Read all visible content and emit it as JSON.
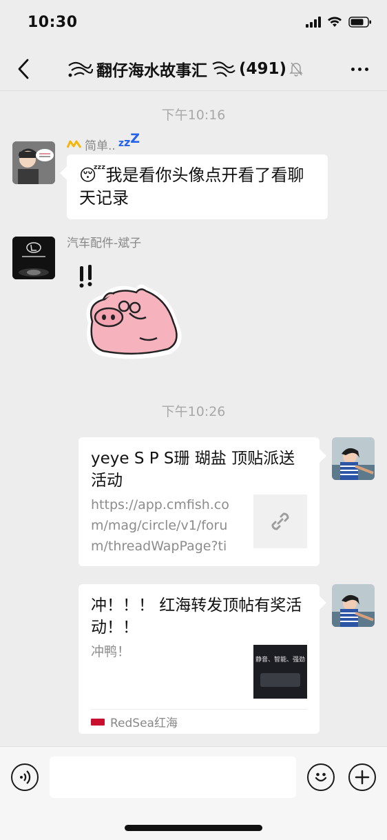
{
  "status_bar": {
    "time": "10:30",
    "icons": [
      "signal-icon",
      "wifi-icon",
      "battery-icon"
    ]
  },
  "nav": {
    "back_icon": "chevron-left-icon",
    "title": "翻仔海水故事汇",
    "member_count": "(491)",
    "mute_icon": "bell-off-icon",
    "more_icon": "ellipsis-icon"
  },
  "messages": {
    "time1": "下午10:16",
    "msg1": {
      "sender": "简单..",
      "text_emoji": "😴",
      "text": "我是看你头像点开看了看聊天记录"
    },
    "msg2": {
      "sender": "汽车配件-斌子",
      "sticker": "pig-sticker"
    },
    "time2": "下午10:26",
    "link1": {
      "title": "yeye S P S珊 瑚盐 顶贴派送活动",
      "desc": "https://app.cmfish.com/mag/circle/v1/forum/threadWapPage?tid...",
      "thumb_icon": "link-icon"
    },
    "link2": {
      "title": "冲！！！ 红海转发顶帖有奖活动！！",
      "desc": "冲鸭！",
      "thumb_text": "静音、智能、强劲",
      "source": "RedSea红海"
    }
  },
  "input": {
    "voice_icon": "voice-icon",
    "emoji_icon": "emoji-icon",
    "plus_icon": "plus-icon",
    "value": ""
  },
  "colors": {
    "background": "#ededed",
    "bubble": "#ffffff",
    "muted_text": "#888888"
  }
}
